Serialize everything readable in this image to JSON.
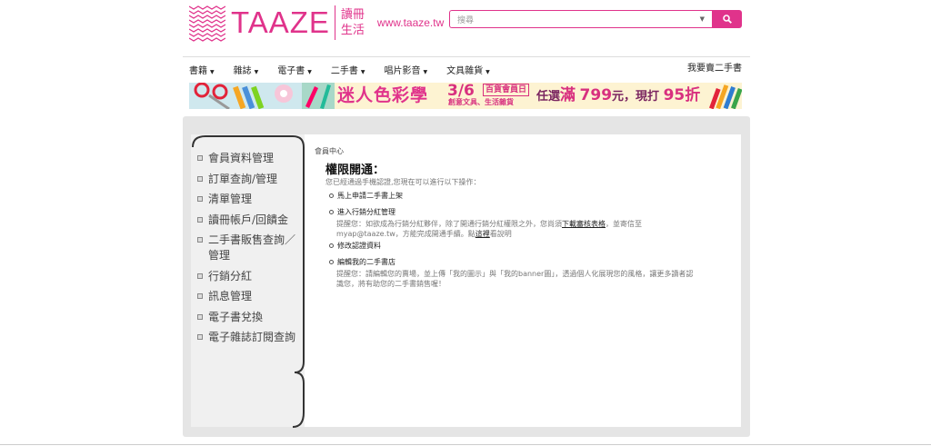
{
  "header": {
    "logo_text": "TAAZE",
    "logo_cn": "讀冊生活",
    "logo_url": "www.taaze.tw"
  },
  "search": {
    "placeholder": "搜尋",
    "button_icon": "search-icon"
  },
  "nav": {
    "items": [
      "書籍",
      "雜誌",
      "電子書",
      "二手書",
      "唱片影音",
      "文具雜貨"
    ],
    "right_link": "我要賣二手書"
  },
  "banner": {
    "main": "迷人色彩學",
    "date": "3/6",
    "sub1": "百貨會員日",
    "sub2": "創意文具、生活雜貨",
    "offer_prefix": "任選",
    "offer_full": "滿",
    "offer_amount": "799",
    "offer_mid": "元，現打",
    "offer_discount": "95",
    "offer_suffix": "折"
  },
  "sidebar": {
    "items": [
      "會員資料管理",
      "訂單查詢/管理",
      "清單管理",
      "讀冊帳戶/回饋金",
      "二手書販售查詢／管理",
      "行銷分紅",
      "訊息管理",
      "電子書兌換",
      "電子雜誌訂閱查詢"
    ]
  },
  "main": {
    "breadcrumb": "會員中心",
    "title": "權限開通：",
    "intro": "您已經通過手機認證,您現在可以進行以下操作：",
    "options": [
      {
        "label": "馬上申請二手書上架"
      },
      {
        "label": "進入行銷分紅管理",
        "note_a": "提醒您：如欲成為行銷分紅夥伴，除了開通行銷分紅權限之外，您尚須",
        "note_link": "下載審核表格",
        "note_b": "，並寄信至myap@taaze.tw，方能完成開通手續。點",
        "note_link2": "這裡",
        "note_c": "看說明"
      },
      {
        "label": "修改認證資料"
      },
      {
        "label": "編輯我的二手書店",
        "note_a": "提醒您：請編輯您的賣場，並上傳「我的圖示」與「我的banner圖」，透過個人化展現您的風格，讓更多讀者認識您，將有助您的二手書銷售喔！"
      }
    ]
  },
  "colors": {
    "brand": "#e0338b"
  }
}
